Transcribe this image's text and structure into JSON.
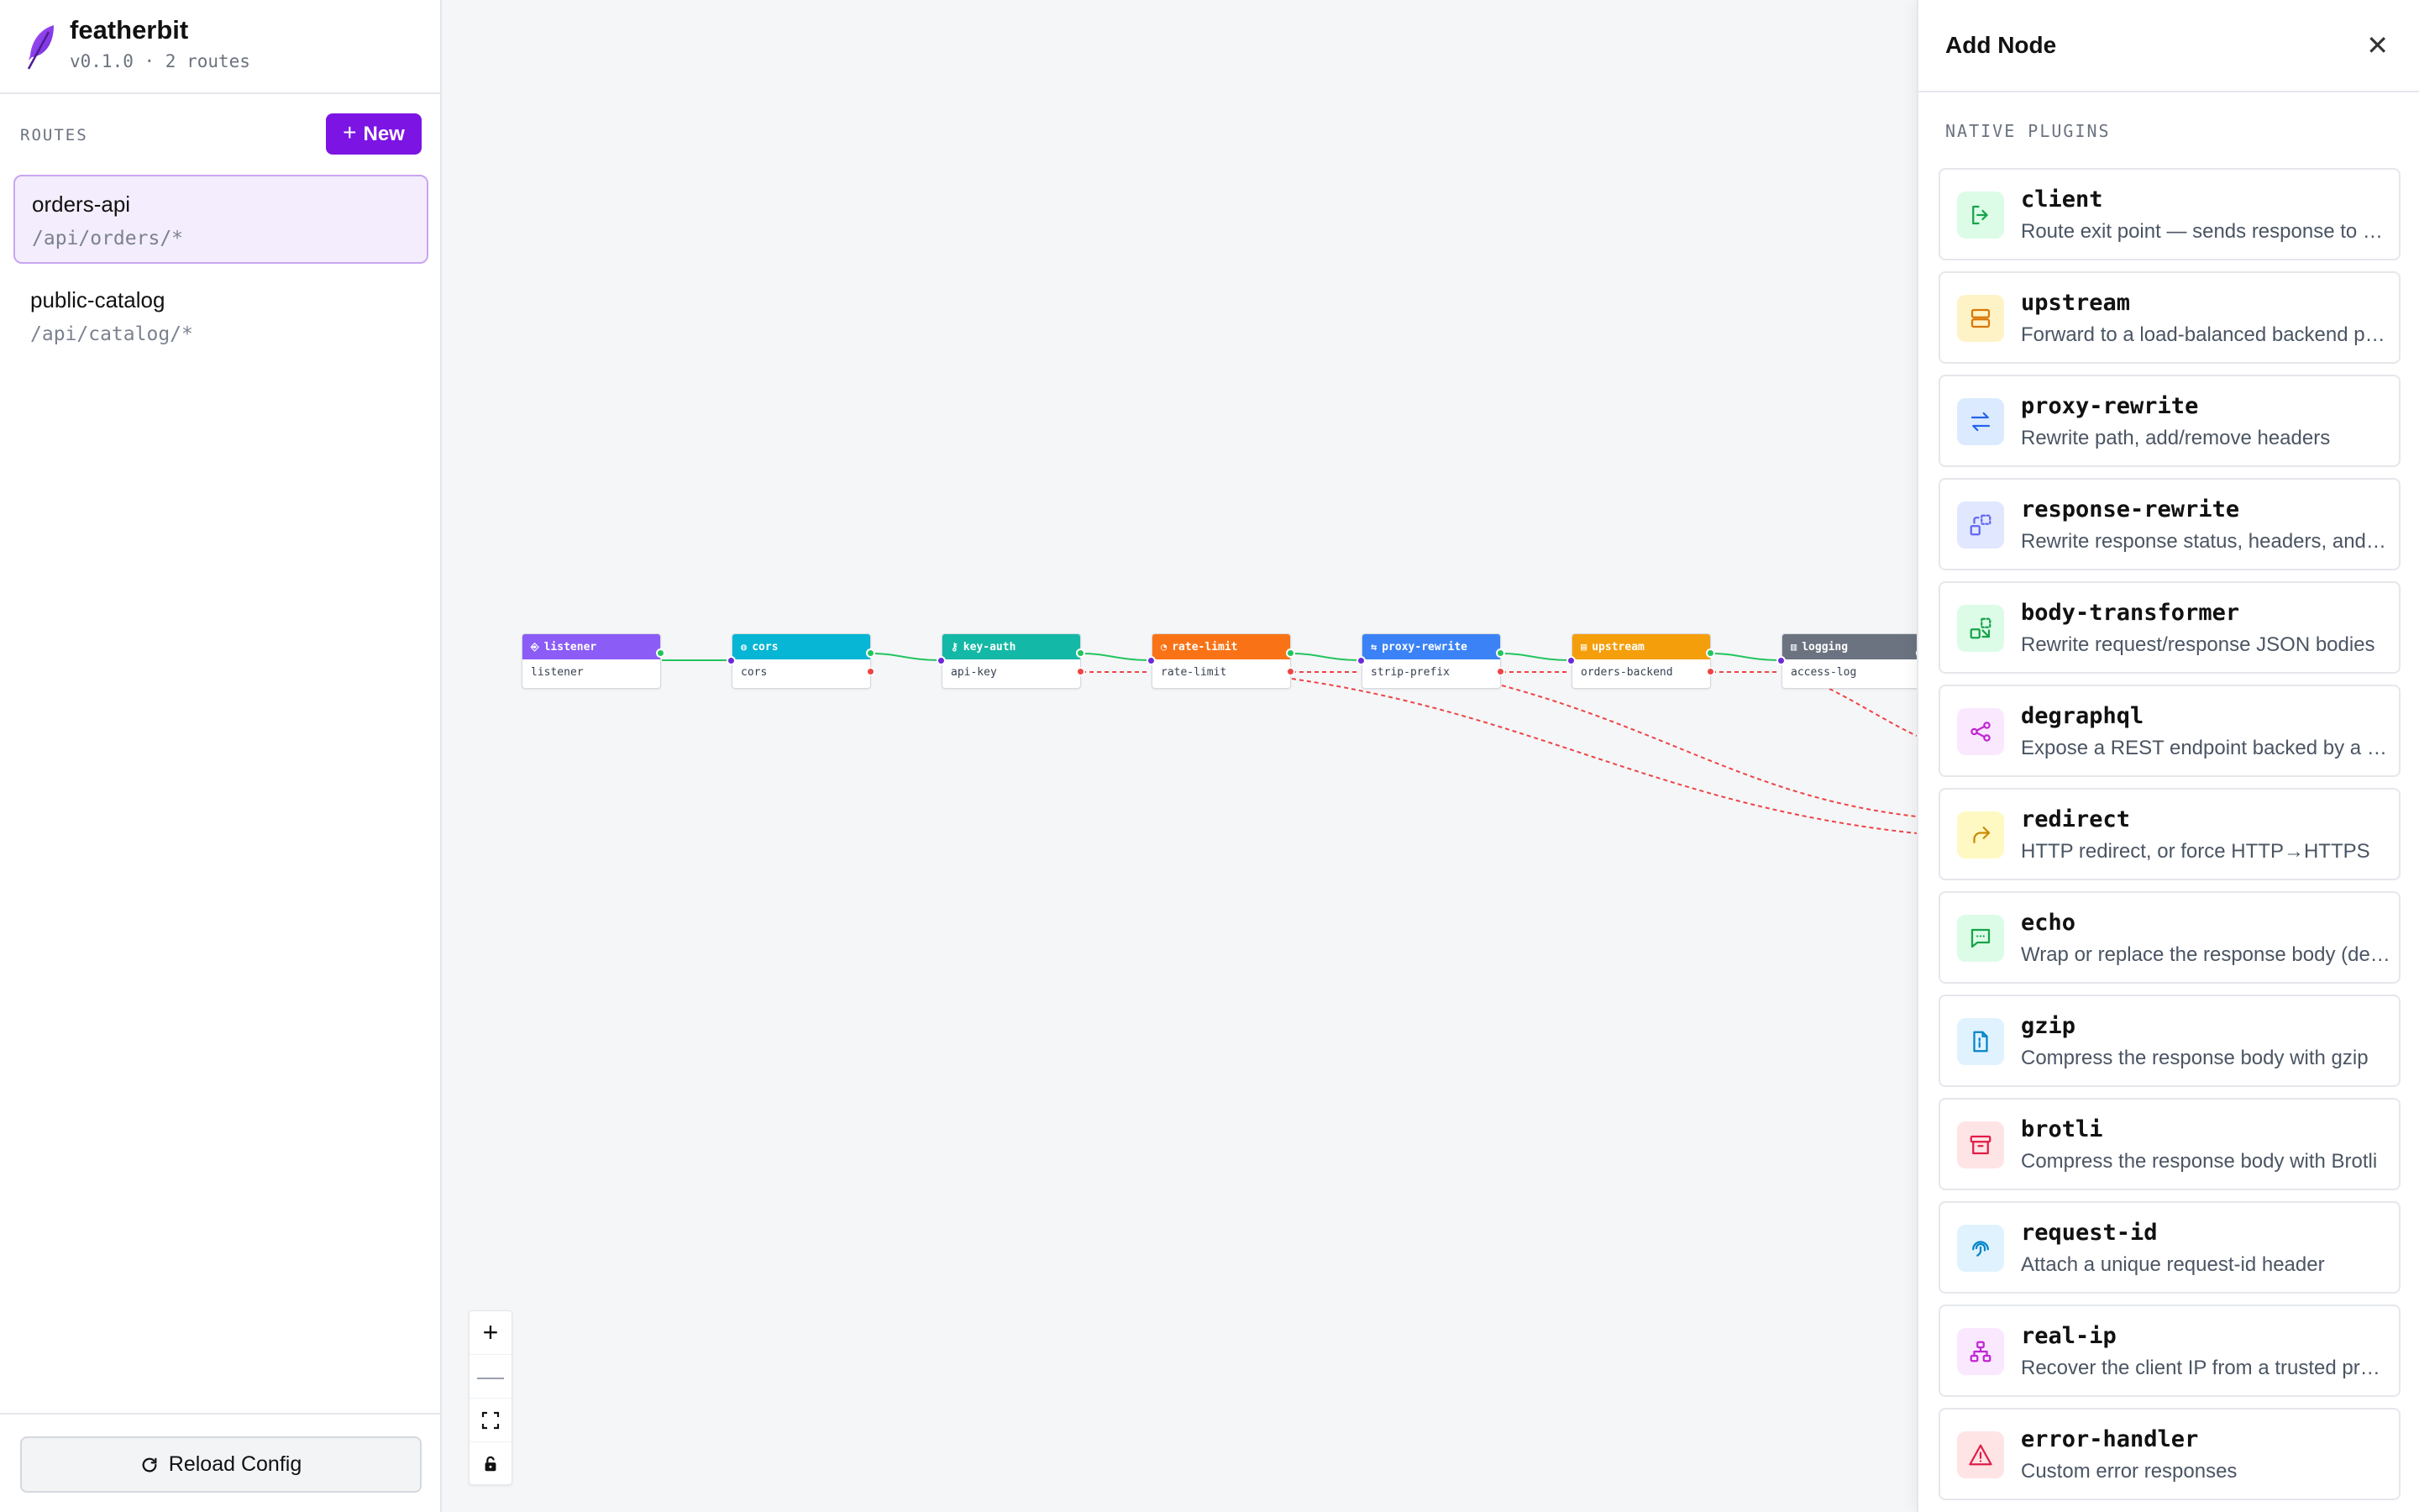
{
  "brand": {
    "name": "featherbit",
    "meta": "v0.1.0 · 2 routes"
  },
  "routes": {
    "title": "ROUTES",
    "new_label": "New",
    "items": [
      {
        "name": "orders-api",
        "path": "/api/orders/*",
        "active": true
      },
      {
        "name": "public-catalog",
        "path": "/api/catalog/*",
        "active": false
      }
    ]
  },
  "reload_label": "Reload Config",
  "canvas": {
    "nodes": [
      {
        "type": "listener",
        "name": "listener",
        "color": "#8b5cf6",
        "icon": "login-icon"
      },
      {
        "type": "cors",
        "name": "cors",
        "color": "#06b6d4",
        "icon": "globe-icon"
      },
      {
        "type": "key-auth",
        "name": "api-key",
        "color": "#14b8a6",
        "icon": "key-icon"
      },
      {
        "type": "rate-limit",
        "name": "rate-limit",
        "color": "#f97316",
        "icon": "gauge-icon"
      },
      {
        "type": "proxy-rewrite",
        "name": "strip-prefix",
        "color": "#3b82f6",
        "icon": "swap-icon"
      },
      {
        "type": "upstream",
        "name": "orders-backend",
        "color": "#f59e0b",
        "icon": "server-icon"
      },
      {
        "type": "logging",
        "name": "access-log",
        "color": "#6b7280",
        "icon": "log-icon"
      }
    ]
  },
  "zoom_controls": [
    "zoom-in",
    "zoom-out",
    "fit-view",
    "lock"
  ],
  "panel": {
    "title": "Add Node",
    "section": "NATIVE PLUGINS",
    "plugins": [
      {
        "name": "client",
        "desc": "Route exit point — sends response to client",
        "icon": "exit-icon",
        "color": "#16a34a",
        "bg": "#dcfce7"
      },
      {
        "name": "upstream",
        "desc": "Forward to a load-balanced backend pool",
        "icon": "server-icon",
        "color": "#d97706",
        "bg": "#fef3c7"
      },
      {
        "name": "proxy-rewrite",
        "desc": "Rewrite path, add/remove headers",
        "icon": "swap-icon",
        "color": "#2563eb",
        "bg": "#dbeafe"
      },
      {
        "name": "response-rewrite",
        "desc": "Rewrite response status, headers, and body",
        "icon": "replace-icon",
        "color": "#6366f1",
        "bg": "#e0e7ff"
      },
      {
        "name": "body-transformer",
        "desc": "Rewrite request/response JSON bodies",
        "icon": "transform-icon",
        "color": "#16a34a",
        "bg": "#dcfce7"
      },
      {
        "name": "degraphql",
        "desc": "Expose a REST endpoint backed by a GraphQL query",
        "icon": "share-icon",
        "color": "#c026d3",
        "bg": "#fae8ff"
      },
      {
        "name": "redirect",
        "desc": "HTTP redirect, or force HTTP→HTTPS",
        "icon": "redirect-icon",
        "color": "#ca8a04",
        "bg": "#fef9c3"
      },
      {
        "name": "echo",
        "desc": "Wrap or replace the response body (debug)",
        "icon": "chat-icon",
        "color": "#16a34a",
        "bg": "#dcfce7"
      },
      {
        "name": "gzip",
        "desc": "Compress the response body with gzip",
        "icon": "file-zip-icon",
        "color": "#0284c7",
        "bg": "#e0f2fe"
      },
      {
        "name": "brotli",
        "desc": "Compress the response body with Brotli",
        "icon": "archive-icon",
        "color": "#e11d48",
        "bg": "#ffe4e6"
      },
      {
        "name": "request-id",
        "desc": "Attach a unique request-id header",
        "icon": "fingerprint-icon",
        "color": "#0284c7",
        "bg": "#e0f2fe"
      },
      {
        "name": "real-ip",
        "desc": "Recover the client IP from a trusted proxy",
        "icon": "network-icon",
        "color": "#c026d3",
        "bg": "#fae8ff"
      },
      {
        "name": "error-handler",
        "desc": "Custom error responses",
        "icon": "warning-icon",
        "color": "#e11d48",
        "bg": "#ffe4e6"
      }
    ]
  }
}
